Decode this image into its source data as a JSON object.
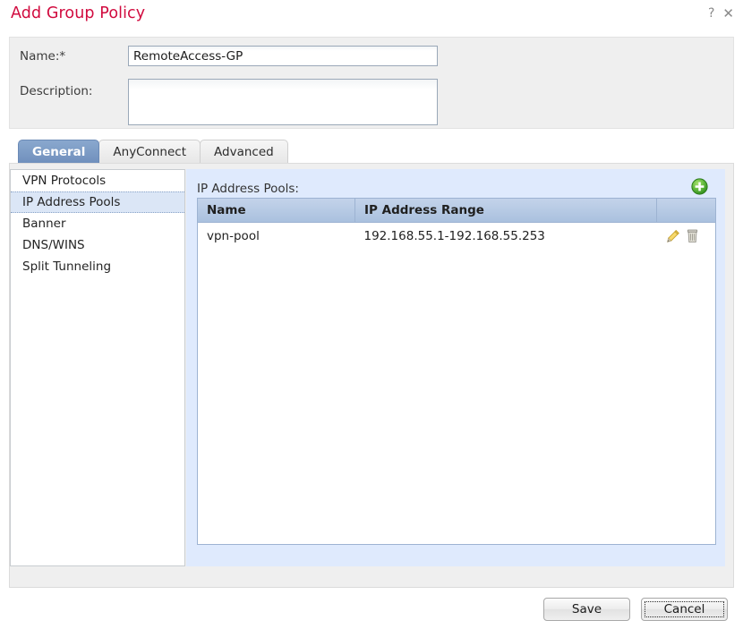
{
  "dialog": {
    "title": "Add Group Policy",
    "help_icon": "question-mark-icon",
    "close_icon": "close-icon"
  },
  "form": {
    "name_label": "Name:*",
    "name_value": "RemoteAccess-GP",
    "name_placeholder": "",
    "description_label": "Description:",
    "description_value": "",
    "description_placeholder": ""
  },
  "tabs": [
    {
      "label": "General",
      "active": true
    },
    {
      "label": "AnyConnect",
      "active": false
    },
    {
      "label": "Advanced",
      "active": false
    }
  ],
  "sidebar": {
    "items": [
      {
        "label": "VPN Protocols",
        "selected": false
      },
      {
        "label": "IP Address Pools",
        "selected": true
      },
      {
        "label": "Banner",
        "selected": false
      },
      {
        "label": "DNS/WINS",
        "selected": false
      },
      {
        "label": "Split Tunneling",
        "selected": false
      }
    ]
  },
  "detail": {
    "section_label": "IP Address Pools:",
    "add_icon": "add-plus-icon",
    "table": {
      "columns": [
        "Name",
        "IP Address Range",
        ""
      ],
      "rows": [
        {
          "name": "vpn-pool",
          "range": "192.168.55.1-192.168.55.253",
          "edit_icon": "pencil-edit-icon",
          "delete_icon": "trash-delete-icon"
        }
      ]
    }
  },
  "footer": {
    "save_label": "Save",
    "cancel_label": "Cancel"
  },
  "colors": {
    "title_red": "#d10b3f",
    "active_tab_blue": "#7b9cc7",
    "panel_blue": "#dfeafd",
    "table_header_blue": "#a9c0de",
    "selection_blue": "#dbe6f6",
    "add_green": "#4aa832"
  }
}
